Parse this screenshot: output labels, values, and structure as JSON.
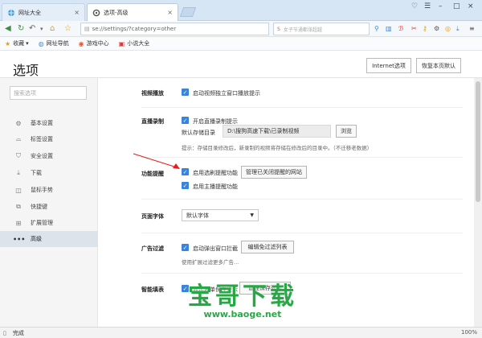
{
  "tabs": [
    {
      "label": "网址大全",
      "close": "×"
    },
    {
      "label": "选项-高级",
      "close": "×"
    }
  ],
  "window_controls": [
    "♡",
    "☰",
    "–",
    "□",
    "×"
  ],
  "nav": {
    "url": "se://settings/?category=other",
    "search_placeholder": "女子节通都涨超越",
    "favorites_label": "收藏",
    "bookmarks": [
      "网址导航",
      "游戏中心",
      "小说大全"
    ]
  },
  "page": {
    "title": "选项",
    "internet_options_btn": "Internet选项",
    "restore_defaults_btn": "恢复本页默认"
  },
  "sidebar": {
    "search_placeholder": "搜索选项",
    "items": [
      {
        "label": "基本设置",
        "icon": "gear-icon"
      },
      {
        "label": "标签设置",
        "icon": "tab-icon"
      },
      {
        "label": "安全设置",
        "icon": "shield-icon"
      },
      {
        "label": "下载",
        "icon": "download-icon"
      },
      {
        "label": "鼠标手势",
        "icon": "mouse-icon"
      },
      {
        "label": "快捷键",
        "icon": "shortcut-icon"
      },
      {
        "label": "扩展管理",
        "icon": "extension-icon"
      },
      {
        "label": "高级",
        "icon": "more-icon"
      }
    ]
  },
  "settings": {
    "video": {
      "label": "视频播放",
      "option": "启动视频独立窗口播放提示"
    },
    "live": {
      "label": "直播录制",
      "option": "开启直播录制提示",
      "dir_label": "默认存储目录",
      "dir_value": "D:\\搜狗高速下载\\已录制视频",
      "browse_btn": "浏览",
      "hint": "提示：存储目录修改后，新录制的视频将存储在修改后的目录中。（不迁移老数据）"
    },
    "feature": {
      "label": "功能提醒",
      "option1": "启用选刷提醒功能",
      "manage_btn": "管理已关闭提醒的网站",
      "option2": "启用主播提醒功能"
    },
    "font": {
      "label": "页面字体",
      "value": "默认字体"
    },
    "adblock": {
      "label": "广告过滤",
      "option": "启动弹出窗口拦截",
      "edit_btn": "编辑免过滤列表",
      "hint": "使用扩展过滤更多广告..."
    },
    "autofill": {
      "label": "智能填表",
      "option": "显示表单保存提示",
      "btn": "管理保存列表"
    }
  },
  "status": {
    "text": "完成",
    "zoom": "100%"
  },
  "watermark": {
    "text": "宝哥下载",
    "url": "www.baoge.net"
  }
}
